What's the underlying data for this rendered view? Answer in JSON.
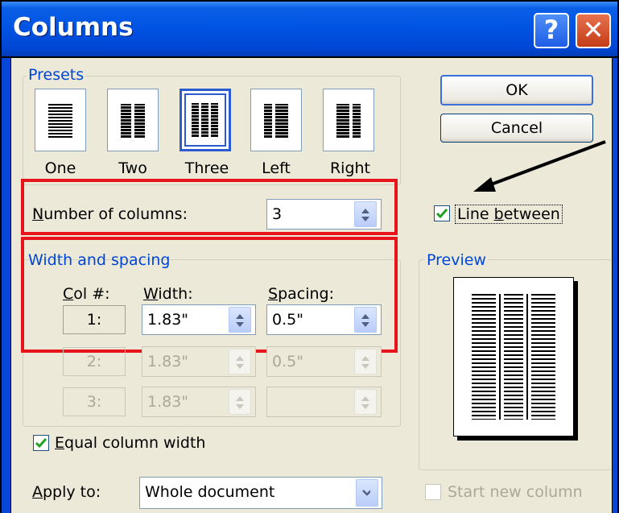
{
  "window": {
    "title": "Columns",
    "help_glyph": "?",
    "close_glyph": "✕"
  },
  "presets": {
    "legend": "Presets",
    "items": [
      {
        "label": "One"
      },
      {
        "label": "Two"
      },
      {
        "label": "Three",
        "selected": true
      },
      {
        "label": "Left"
      },
      {
        "label": "Right"
      }
    ]
  },
  "buttons": {
    "ok": "OK",
    "cancel": "Cancel"
  },
  "number_of_columns": {
    "label_prefix": "N",
    "label_rest": "umber of columns:",
    "value": "3"
  },
  "line_between": {
    "label_pre": "Line ",
    "label_u": "b",
    "label_post": "etween",
    "checked": true
  },
  "width_spacing": {
    "legend": "Width and spacing",
    "col_header_u": "C",
    "col_header_rest": "ol #:",
    "width_header_u": "W",
    "width_header_rest": "idth:",
    "spacing_header_u": "S",
    "spacing_header_rest": "pacing:",
    "rows": [
      {
        "col": "1:",
        "width": "1.83\"",
        "spacing": "0.5\"",
        "enabled": true
      },
      {
        "col": "2:",
        "width": "1.83\"",
        "spacing": "0.5\"",
        "enabled": false
      },
      {
        "col": "3:",
        "width": "1.83\"",
        "spacing": "",
        "enabled": false
      }
    ]
  },
  "equal_column_width": {
    "label_u": "E",
    "label_rest": "qual column width",
    "checked": true
  },
  "preview": {
    "legend": "Preview"
  },
  "apply_to": {
    "label_u": "A",
    "label_rest": "pply to:",
    "value": "Whole document"
  },
  "start_new_column": {
    "label": "Start new column",
    "checked": false,
    "enabled": false
  },
  "colors": {
    "highlight_box": "#e8141b",
    "titlebar": "#0054e3",
    "legend_text": "#0046d5"
  }
}
